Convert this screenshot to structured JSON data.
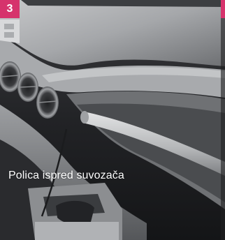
{
  "badge": {
    "number": "3",
    "color": "#d6336c"
  },
  "caption": "Polica ispred suvozača",
  "scene": {
    "subject": "car-interior-passenger-dashboard-shelf",
    "palette": {
      "dash_light": "#b9babc",
      "dash_mid": "#8d8f92",
      "dash_dark": "#4b4d50",
      "shadow": "#17181a"
    }
  }
}
